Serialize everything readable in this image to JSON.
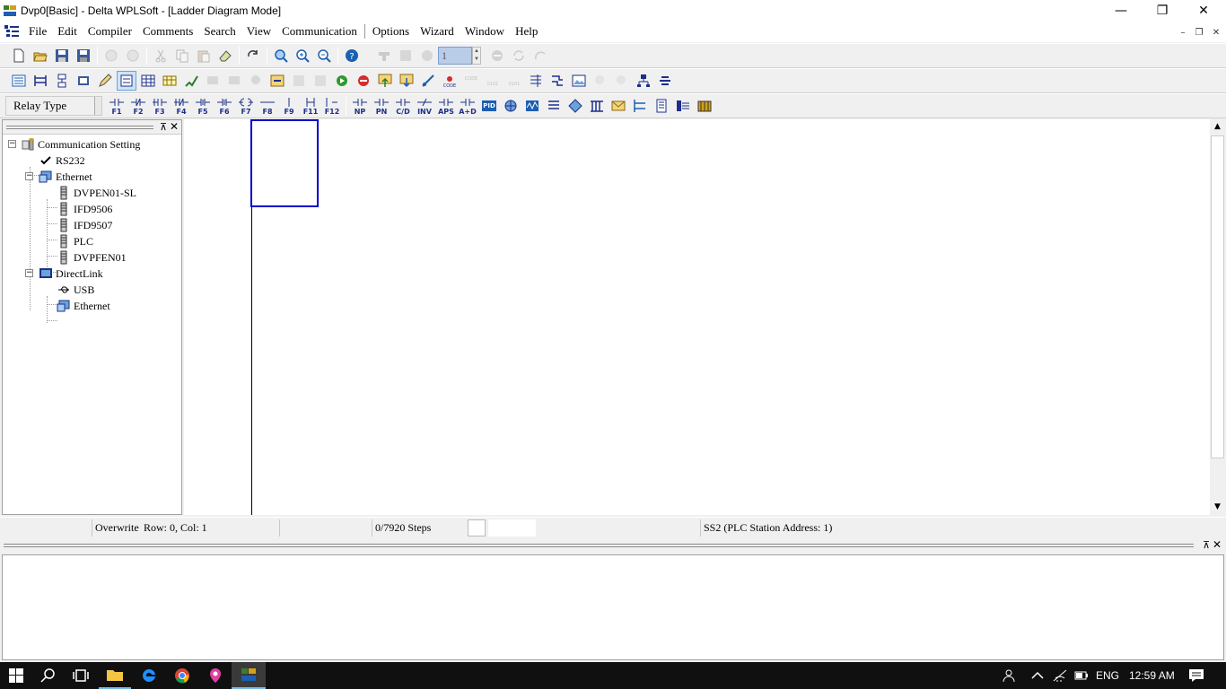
{
  "window": {
    "title": "Dvp0[Basic] - Delta WPLSoft - [Ladder Diagram Mode]",
    "minimize": "—",
    "restore": "❐",
    "close": "✕"
  },
  "menu": {
    "items": [
      {
        "label": "File"
      },
      {
        "label": "Edit"
      },
      {
        "label": "Compiler"
      },
      {
        "label": "Comments"
      },
      {
        "label": "Search"
      },
      {
        "label": "View"
      },
      {
        "label": "Communication"
      },
      {
        "label": "Options"
      },
      {
        "label": "Wizard"
      },
      {
        "label": "Window"
      },
      {
        "label": "Help"
      }
    ],
    "mdi_minimize": "–",
    "mdi_restore": "❐",
    "mdi_close": "✕"
  },
  "toolbar1": {
    "spin_value": "1"
  },
  "toolbar3": {
    "relay_type": "Relay Type",
    "fkeys": [
      "F1",
      "F2",
      "F3",
      "F4",
      "F5",
      "F6",
      "F7",
      "F8",
      "F9",
      "F11",
      "F12"
    ],
    "extra_labels": [
      "NP",
      "PN",
      "C/D",
      "INV",
      "APS",
      "A+D",
      "PID"
    ]
  },
  "tree": {
    "root": "Communication Setting",
    "rs232": "RS232",
    "ethernet": "Ethernet",
    "ethernet_children": [
      "DVPEN01-SL",
      "IFD9506",
      "IFD9507",
      "PLC",
      "DVPFEN01"
    ],
    "directlink": "DirectLink",
    "directlink_children": [
      "USB",
      "Ethernet"
    ]
  },
  "panels": {
    "pin": "⊼",
    "close": "✕"
  },
  "status": {
    "mode": "Overwrite",
    "position": "Row: 0, Col: 1",
    "steps": "0/7920 Steps",
    "station": "SS2 (PLC Station Address: 1)"
  },
  "taskbar": {
    "language": "ENG",
    "time": "12:59 AM"
  }
}
